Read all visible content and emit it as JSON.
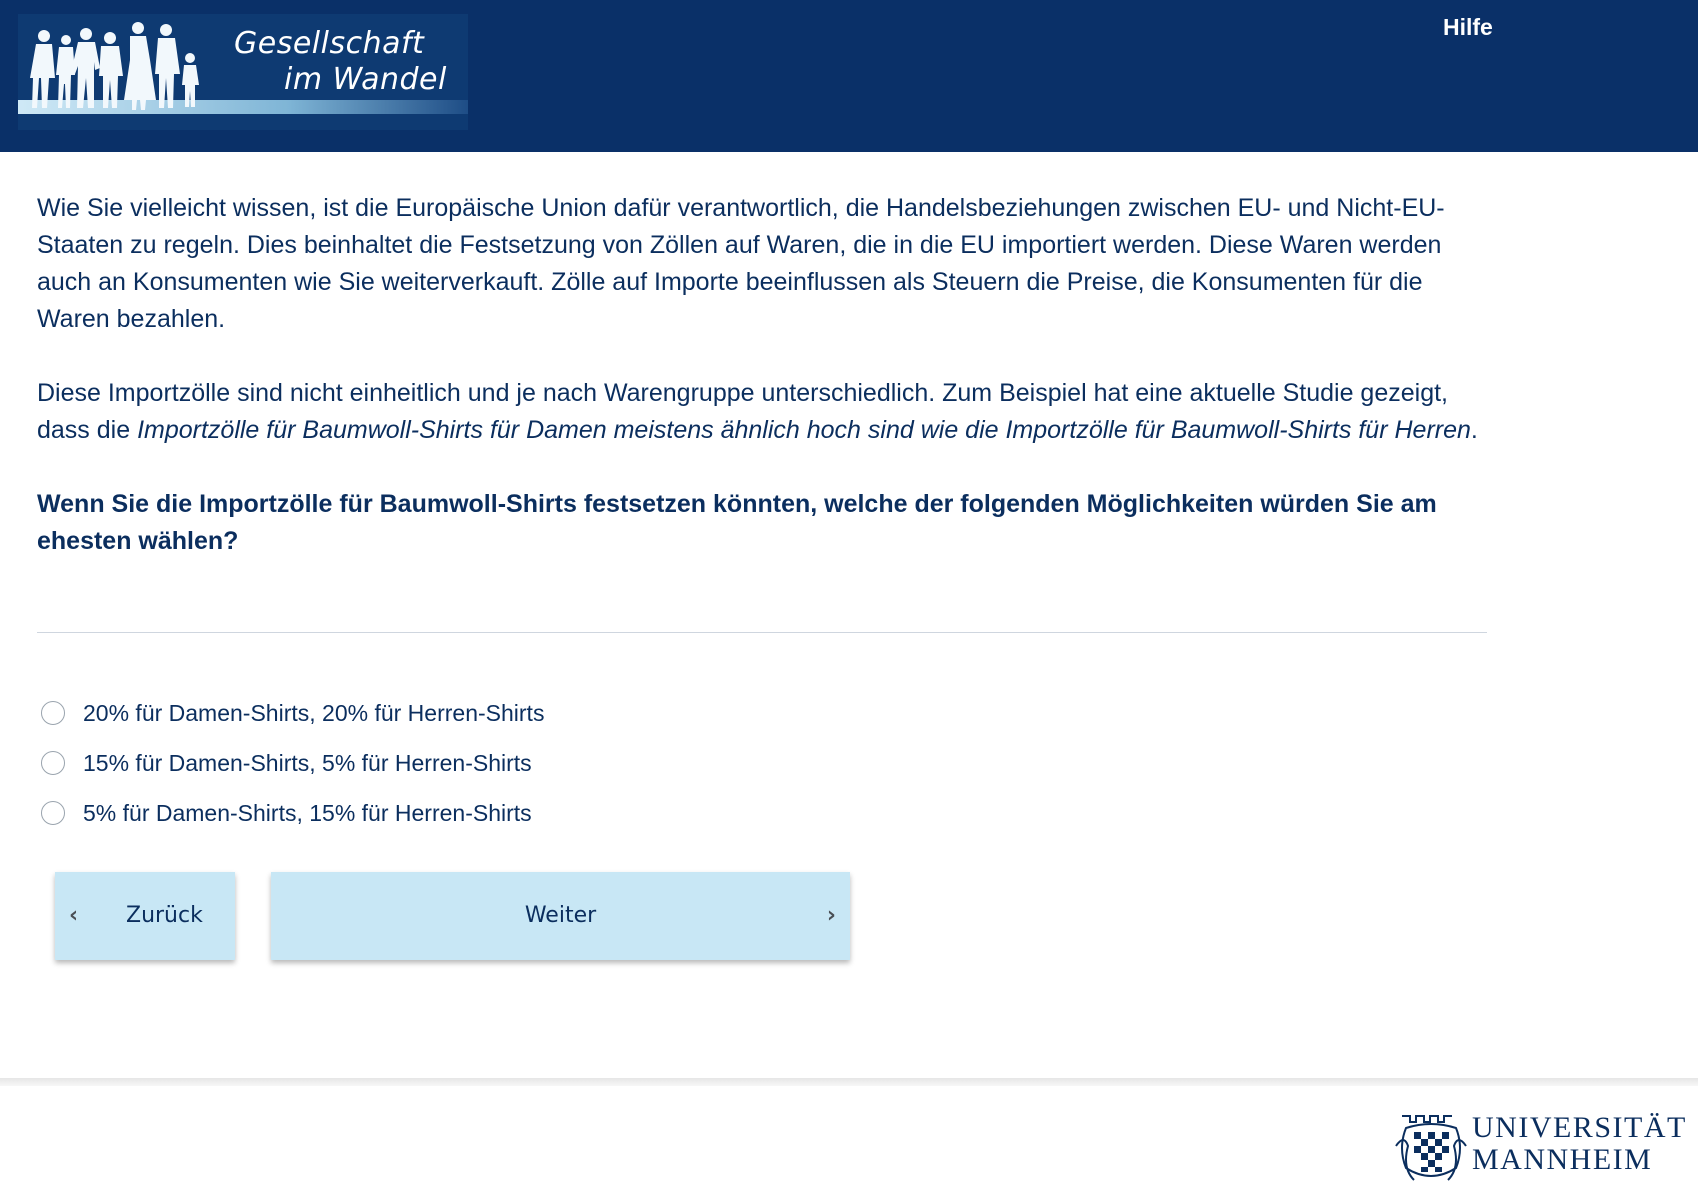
{
  "header": {
    "logo": {
      "line1": "Gesellschaft",
      "line2": "im Wandel"
    },
    "help_label": "Hilfe"
  },
  "survey": {
    "intro_paragraph": "Wie Sie vielleicht wissen, ist die Europäische Union dafür verantwortlich, die Handelsbeziehungen zwischen EU- und Nicht-EU-Staaten zu regeln. Dies beinhaltet die Festsetzung von Zöllen auf Waren, die in die EU importiert werden. Diese Waren werden auch an Konsumenten wie Sie weiterverkauft. Zölle auf Importe beeinflussen als Steuern die Preise, die Konsumenten für die Waren bezahlen.",
    "study_paragraph_prefix": "Diese Importzölle sind nicht einheitlich und je nach Warengruppe unterschiedlich. Zum Beispiel hat eine aktuelle Studie gezeigt, dass die ",
    "study_paragraph_italic": "Importzölle für Baumwoll-Shirts für Damen meistens ähnlich hoch sind wie die Importzölle für Baumwoll-Shirts für Herren",
    "study_paragraph_suffix": ".",
    "question": "Wenn Sie die Importzölle für Baumwoll-Shirts festsetzen könnten, welche der folgenden Möglichkeiten würden Sie am ehesten wählen?",
    "options": [
      {
        "label": "20% für Damen-Shirts, 20% für Herren-Shirts",
        "selected": false
      },
      {
        "label": "15% für Damen-Shirts, 5% für Herren-Shirts",
        "selected": false
      },
      {
        "label": "5% für Damen-Shirts, 15% für Herren-Shirts",
        "selected": false
      }
    ]
  },
  "navigation": {
    "back_label": "Zurück",
    "next_label": "Weiter"
  },
  "footer": {
    "university_line1": "UNIVERSITÄT",
    "university_line2": "MANNHEIM"
  },
  "colors": {
    "header_bg": "#0a3068",
    "text": "#0b2e5e",
    "button_bg": "#c8e7f5"
  }
}
